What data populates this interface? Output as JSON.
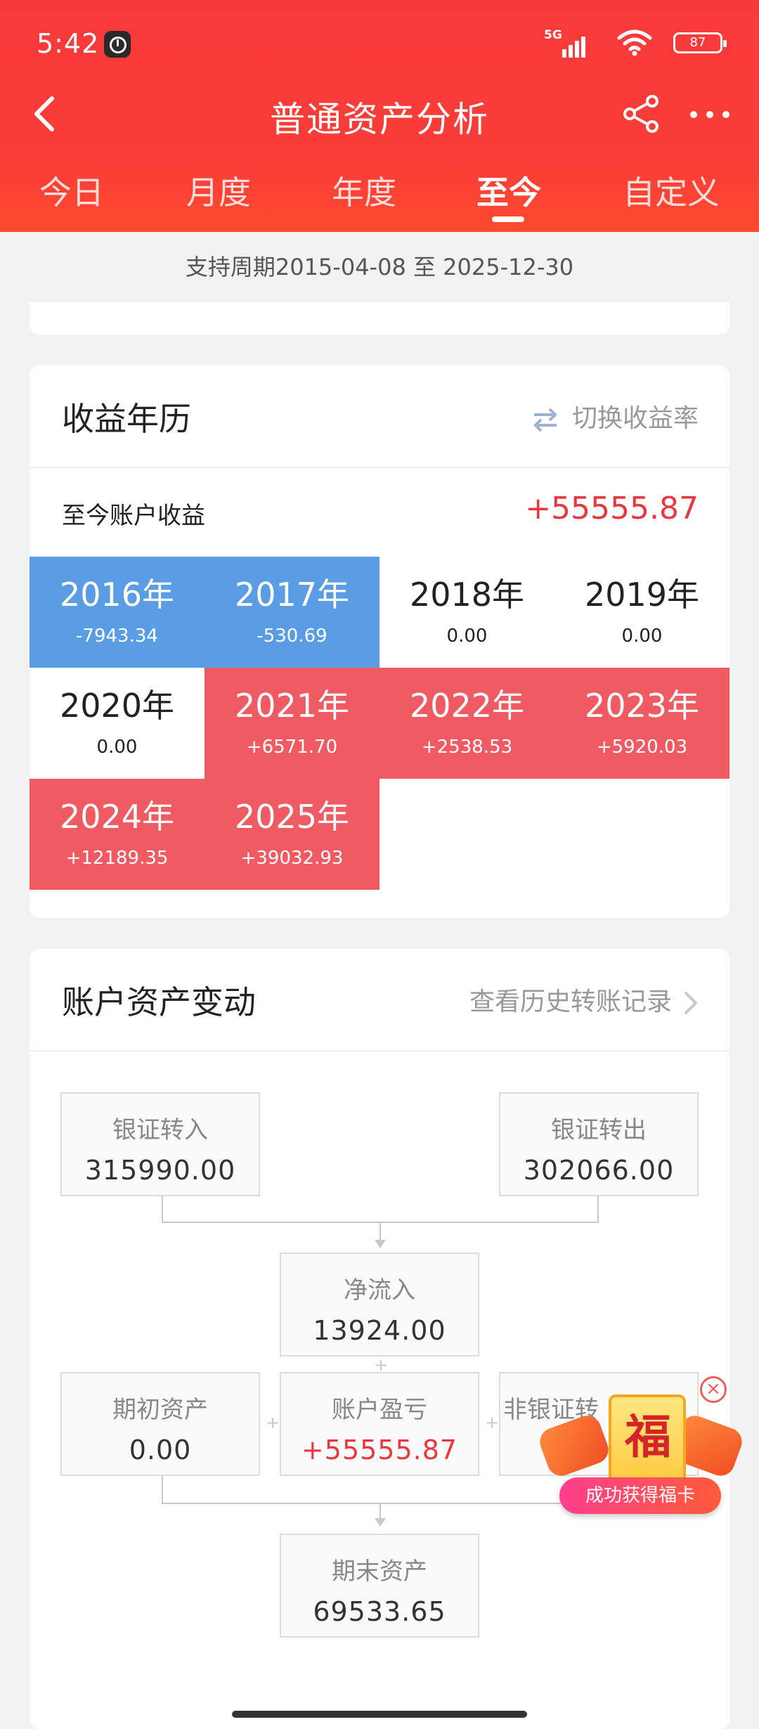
{
  "status_bar": {
    "time": "5:42",
    "network": "5G",
    "battery": "87"
  },
  "header": {
    "title": "普通资产分析"
  },
  "tabs": [
    {
      "label": "今日"
    },
    {
      "label": "月度"
    },
    {
      "label": "年度"
    },
    {
      "label": "至今",
      "active": true
    },
    {
      "label": "自定义"
    }
  ],
  "period_text": "支持周期2015-04-08 至 2025-12-30",
  "calendar": {
    "title": "收益年历",
    "toggle_label": "切换收益率",
    "total_label": "至今账户收益",
    "total_value": "+55555.87",
    "years": [
      {
        "year": "2016年",
        "value": "-7943.34",
        "kind": "blue"
      },
      {
        "year": "2017年",
        "value": "-530.69",
        "kind": "blue"
      },
      {
        "year": "2018年",
        "value": "0.00",
        "kind": "plain"
      },
      {
        "year": "2019年",
        "value": "0.00",
        "kind": "plain"
      },
      {
        "year": "2020年",
        "value": "0.00",
        "kind": "plain"
      },
      {
        "year": "2021年",
        "value": "+6571.70",
        "kind": "red"
      },
      {
        "year": "2022年",
        "value": "+2538.53",
        "kind": "red"
      },
      {
        "year": "2023年",
        "value": "+5920.03",
        "kind": "red"
      },
      {
        "year": "2024年",
        "value": "+12189.35",
        "kind": "red"
      },
      {
        "year": "2025年",
        "value": "+39032.93",
        "kind": "red"
      }
    ]
  },
  "assets": {
    "title": "账户资产变动",
    "history_link": "查看历史转账记录",
    "bank_in": {
      "label": "银证转入",
      "value": "315990.00"
    },
    "bank_out": {
      "label": "银证转出",
      "value": "302066.00"
    },
    "net_inflow": {
      "label": "净流入",
      "value": "13924.00"
    },
    "opening": {
      "label": "期初资产",
      "value": "0.00"
    },
    "pnl": {
      "label": "账户盈亏",
      "value": "+55555.87"
    },
    "non_bank": {
      "label": "非银证转"
    },
    "closing": {
      "label": "期末资产",
      "value": "69533.65"
    }
  },
  "badge": {
    "glyph": "福",
    "text": "成功获得福卡"
  },
  "colors": {
    "header_red": "#f8393a",
    "loss_blue": "#5a9de4",
    "gain_red": "#ef5a63",
    "value_red": "#e9373f"
  }
}
